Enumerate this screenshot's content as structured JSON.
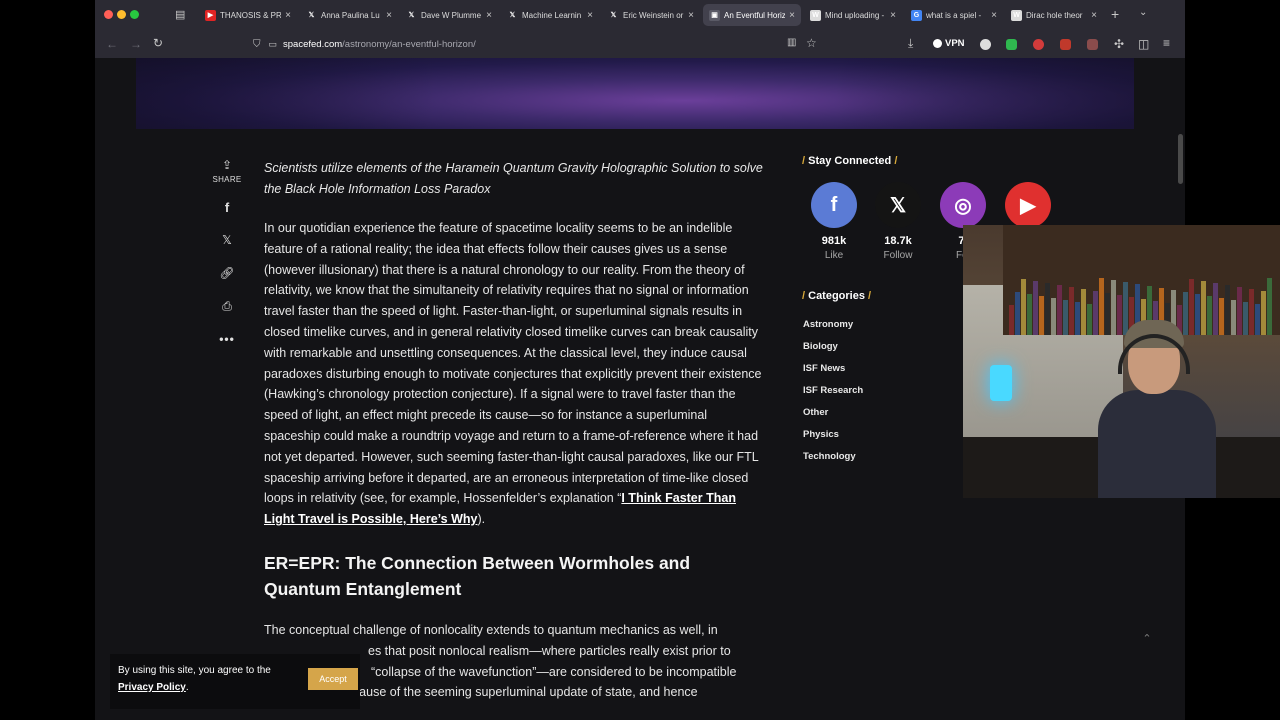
{
  "browser": {
    "tabs": [
      {
        "label": "THANOSIS & PR",
        "color": "#e02424",
        "glyph": "▶"
      },
      {
        "label": "Anna Paulina Lu",
        "color": "#2b2a33",
        "glyph": "𝕏"
      },
      {
        "label": "Dave W Plumme",
        "color": "#2b2a33",
        "glyph": "𝕏"
      },
      {
        "label": "Machine Learnin",
        "color": "#2b2a33",
        "glyph": "𝕏"
      },
      {
        "label": "Eric Weinstein or",
        "color": "#2b2a33",
        "glyph": "𝕏"
      },
      {
        "label": "An Eventful Horiz",
        "color": "#5a5a66",
        "glyph": "▣"
      },
      {
        "label": "Mind uploading -",
        "color": "#dcdcdc",
        "glyph": "W"
      },
      {
        "label": "what is a spiel -",
        "color": "#4285f4",
        "glyph": "G"
      },
      {
        "label": "Dirac hole theor",
        "color": "#dcdcdc",
        "glyph": "W"
      }
    ],
    "url_domain": "spacefed.com",
    "url_path": "/astronomy/an-eventful-horizon/",
    "vpn_label": "VPN"
  },
  "share": {
    "label": "SHARE",
    "items": [
      "facebook-icon",
      "x-icon",
      "link-icon",
      "print-icon",
      "more-icon"
    ]
  },
  "article": {
    "lede": "Scientists utilize elements of the Haramein Quantum Gravity Holographic Solution to solve the Black Hole Information Loss Paradox",
    "para1": "In our quotidian experience the feature of spacetime locality seems to be an indelible feature of a rational reality; the idea that effects follow their causes gives us a sense (however illusionary) that there is a natural chronology to our reality. From the theory of relativity, we know that the simultaneity of relativity requires that no signal or information travel faster than the speed of light. Faster-than-light, or superluminal signals results in closed timelike curves, and in general relativity closed timelike curves can break causality with remarkable and unsettling consequences. At the classical level, they induce causal paradoxes disturbing enough to motivate conjectures that explicitly prevent their existence (Hawking’s chronology protection conjecture). If a signal were to travel faster than the speed of light, an effect might precede its cause—so for instance a superluminal spaceship could make a roundtrip voyage and return to a frame-of-reference where it had not yet departed. However, such seeming faster-than-light causal paradoxes, like our FTL spaceship arriving before it departed, are an erroneous interpretation of time-like closed loops in relativity (see, for example, Hossenfelder’s explanation “",
    "para1_link": "I Think Faster Than Light Travel is Possible, Here’s Why",
    "para1_end": ").",
    "heading": "ER=EPR: The Connection Between Wormholes and Quantum Entanglement",
    "para2_a": "The conceptual challenge of nonlocality extends to quantum mechanics as well, in",
    "para2_b": "es that posit nonlocal realism—where particles really exist prior to",
    "para2_c": "“collapse of the wavefunction”—are considered to be incompatible",
    "para2_d": "with relativity because of the seeming superluminal update of state, and hence"
  },
  "sidebar": {
    "stay_connected": "Stay Connected",
    "social": [
      {
        "icon": "facebook-icon",
        "glyph": "f",
        "count": "981k",
        "action": "Like",
        "color": "#5b7bd5"
      },
      {
        "icon": "x-icon",
        "glyph": "𝕏",
        "count": "18.7k",
        "action": "Follow",
        "color": "#141414"
      },
      {
        "icon": "instagram-icon",
        "glyph": "◎",
        "count": "7.",
        "action": "Fol",
        "color": "#8c3bb8"
      },
      {
        "icon": "youtube-icon",
        "glyph": "▶",
        "count": "",
        "action": "",
        "color": "#e0302f"
      }
    ],
    "categories_title": "Categories",
    "categories": [
      "Astronomy",
      "Biology",
      "ISF News",
      "ISF Research",
      "Other",
      "Physics",
      "Technology"
    ]
  },
  "cookie": {
    "text": "By using this site, you agree to the",
    "link": "Privacy Policy",
    "end": ".",
    "accept": "Accept"
  }
}
